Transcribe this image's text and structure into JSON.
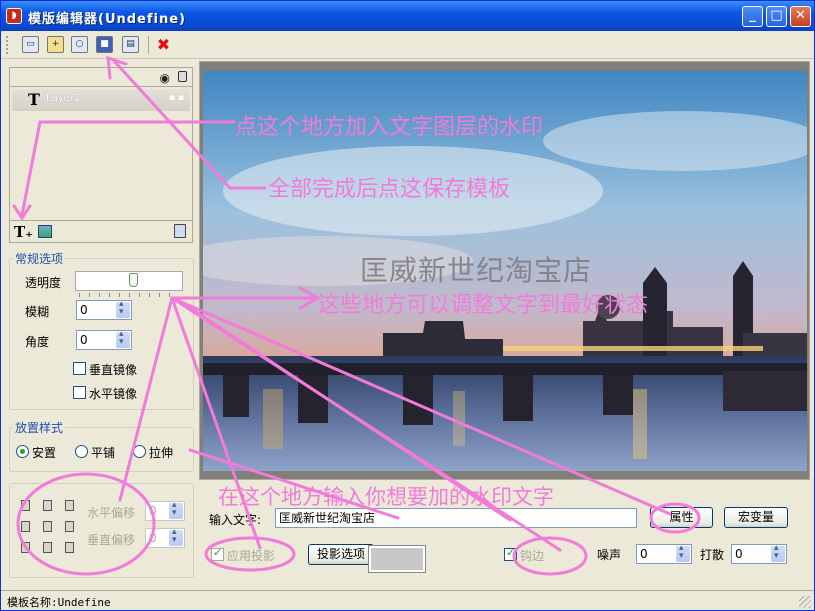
{
  "window": {
    "title": "模版编辑器(Undefine)",
    "app_icon": "editor-logo-icon",
    "min": "_",
    "max": "□",
    "close": "✕"
  },
  "toolbar": {
    "icons": [
      "new-template-icon",
      "open-folder-icon",
      "preview-icon",
      "save-icon",
      "export-icon",
      "delete-icon"
    ],
    "delete_glyph": "✖"
  },
  "layers": {
    "items": [
      {
        "icon": "text-layer-icon",
        "glyph": "T",
        "name": "Layer1",
        "flags": "▪  ▪"
      }
    ],
    "add_text_glyph": "T₊"
  },
  "common": {
    "legend": "常规选项",
    "opacity_label": "透明度",
    "opacity": 0.55,
    "blur_label": "模糊",
    "blur": "0",
    "angle_label": "角度",
    "angle": "0",
    "vflip_label": "垂直镜像",
    "vflip": false,
    "hflip_label": "水平镜像",
    "hflip": false
  },
  "placement": {
    "legend": "放置样式",
    "options": [
      {
        "label": "安置",
        "selected": true
      },
      {
        "label": "平铺",
        "selected": false
      },
      {
        "label": "拉伸",
        "selected": false
      }
    ]
  },
  "offset": {
    "h_label": "水平偏移",
    "h_value": "0",
    "v_label": "垂直偏移",
    "v_value": "0"
  },
  "preview": {
    "watermark": "匡威新世纪淘宝店",
    "image": "city-bridge-night-photo"
  },
  "bottom": {
    "input_label": "输入文字:",
    "input_value": "匡威新世纪淘宝店",
    "props_button": "属性",
    "macro_button": "宏变量",
    "shadow_label": "应用投影",
    "shadow_checked": true,
    "shadow_options_button": "投影选项",
    "shadow_color": "#c8c8c8",
    "stroke_label": "钩边",
    "stroke_checked": true,
    "noise_label": "噪声",
    "noise": "0",
    "scatter_label": "打散",
    "scatter": "0"
  },
  "status": {
    "text": "模板名称:Undefine"
  },
  "annotations": {
    "a1": "点这个地方加入文字图层的水印",
    "a2": "全部完成后点这保存模板",
    "a3": "这些地方可以调整文字到最好状态",
    "a4": "在这个地方输入你想要加的水印文字"
  },
  "colors": {
    "title_bar": "#0a4bd4",
    "window_bg": "#ece9d8",
    "annotation": "#f27bd9",
    "legend": "#1f4fb0"
  }
}
